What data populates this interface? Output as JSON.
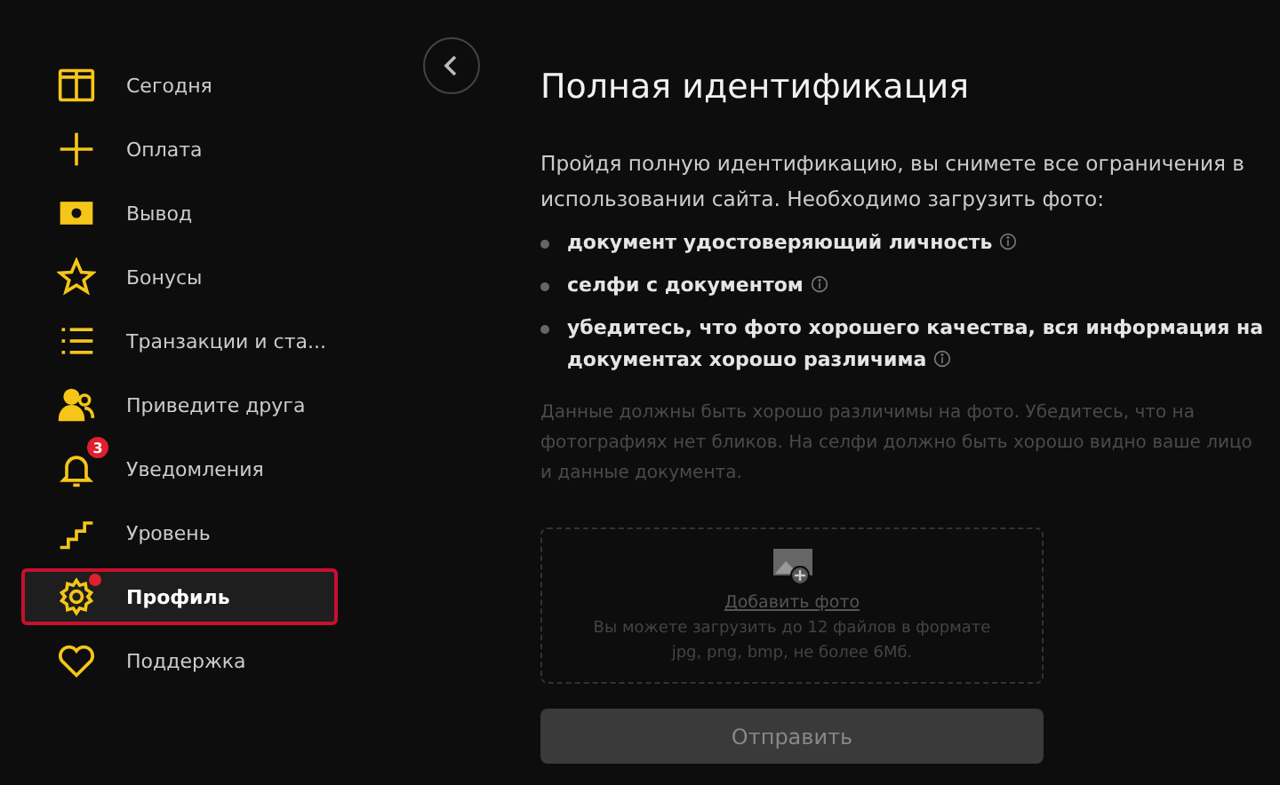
{
  "sidebar": {
    "items": [
      {
        "kind": "today",
        "label": "Сегодня",
        "selected": false
      },
      {
        "kind": "plus",
        "label": "Оплата",
        "selected": false
      },
      {
        "kind": "money",
        "label": "Вывод",
        "selected": false
      },
      {
        "kind": "star",
        "label": "Бонусы",
        "selected": false
      },
      {
        "kind": "list",
        "label": "Транзакции и ста...",
        "selected": false
      },
      {
        "kind": "friends",
        "label": "Приведите друга",
        "selected": false
      },
      {
        "kind": "bell",
        "label": "Уведомления",
        "selected": false,
        "badge": "3"
      },
      {
        "kind": "stairs",
        "label": "Уровень",
        "selected": false
      },
      {
        "kind": "gear",
        "label": "Профиль",
        "selected": true,
        "dot": true
      },
      {
        "kind": "heart",
        "label": "Поддержка",
        "selected": false
      }
    ]
  },
  "page": {
    "title": "Полная идентификация",
    "intro": "Пройдя полную идентификацию, вы снимете все ограничения в использовании сайта. Необходимо загрузить фото:",
    "requirements": [
      "документ удостоверяющий личность",
      "селфи с документом",
      "убедитесь, что фото хорошего качества, вся информация на документах хорошо различима"
    ],
    "note": "Данные должны быть хорошо различимы на фото. Убедитесь, что на фотографиях нет бликов. На селфи должно быть хорошо видно ваше лицо и данные документа.",
    "upload": {
      "link": "Добавить фото",
      "hint": "Вы можете загрузить до 12 файлов в формате jpg, png, bmp, не более 6Мб."
    },
    "submit": {
      "label": "Отправить",
      "disabled": true
    }
  }
}
